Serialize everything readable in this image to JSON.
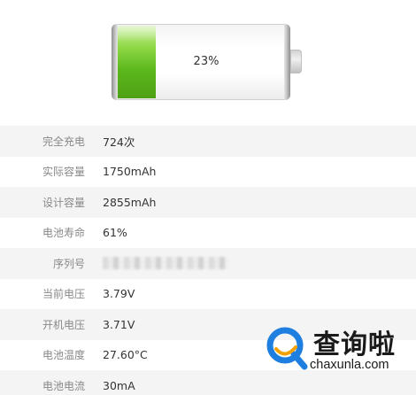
{
  "battery": {
    "percent_text": "23%",
    "level": 0.23,
    "fill_color": "#5cb81d"
  },
  "rows": [
    {
      "label": "完全充电",
      "value": "724次"
    },
    {
      "label": "实际容量",
      "value": "1750mAh"
    },
    {
      "label": "设计容量",
      "value": "2855mAh"
    },
    {
      "label": "电池寿命",
      "value": "61%"
    },
    {
      "label": "序列号",
      "value": ""
    },
    {
      "label": "当前电压",
      "value": "3.79V"
    },
    {
      "label": "开机电压",
      "value": "3.71V"
    },
    {
      "label": "电池温度",
      "value": "27.60°C"
    },
    {
      "label": "电池电流",
      "value": "30mA"
    }
  ],
  "watermark": {
    "title": "查询啦",
    "domain": "chaxunla.com",
    "accent_color": "#1e7fe0",
    "logo_icon": "magnifier-q-logo-icon"
  }
}
